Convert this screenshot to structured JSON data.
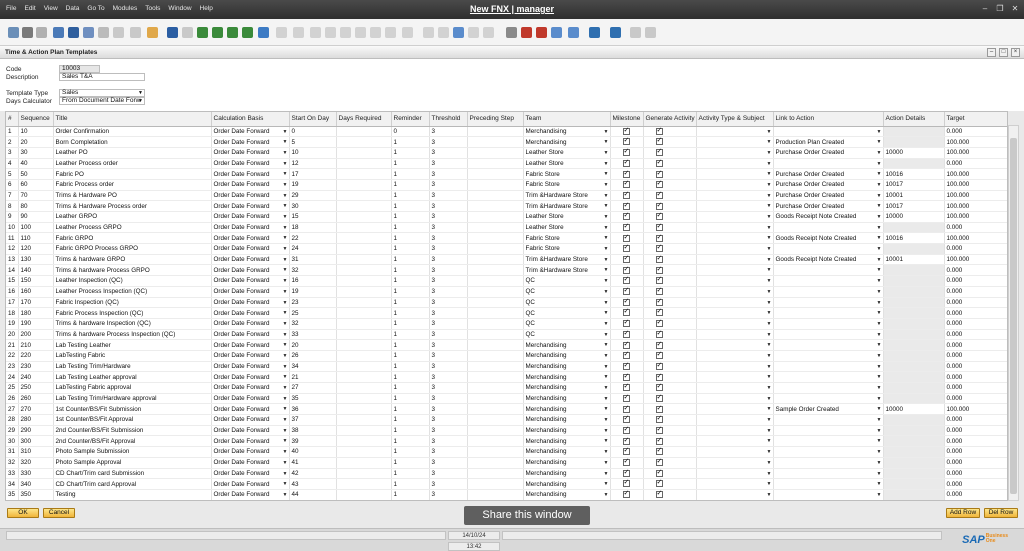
{
  "menu": [
    "File",
    "Edit",
    "View",
    "Data",
    "Go To",
    "Modules",
    "Tools",
    "Window",
    "Help"
  ],
  "app_title": "New FNX | manager",
  "window_title": "Time & Action Plan Templates",
  "form": {
    "code_label": "Code",
    "code": "10003",
    "description_label": "Description",
    "description": "Sales T&A",
    "template_type_label": "Template Type",
    "template_type": "Sales",
    "days_calc_label": "Days Calculator",
    "days_calc": "From Document Date Forw"
  },
  "columns": [
    "#",
    "Sequence",
    "Title",
    "Calculation Basis",
    "Start On Day",
    "Days Required",
    "Reminder",
    "Threshold",
    "Preceding Step",
    "Team",
    "Milestone",
    "Generate Activity",
    "Activity Type & Subject",
    "Link to Action",
    "Action Details",
    "Target"
  ],
  "rows": [
    {
      "n": "1",
      "seq": "10",
      "title": "Order Confirmation",
      "basis": "Order Date Forward",
      "start": "0",
      "rem": "0",
      "thr": "3",
      "team": "Merchandising",
      "link": "",
      "det": "",
      "target": "0.000"
    },
    {
      "n": "2",
      "seq": "20",
      "title": "Born Completation",
      "basis": "Order Date Forward",
      "start": "5",
      "rem": "1",
      "thr": "3",
      "team": "Merchandising",
      "link": "Production Plan Created",
      "det": "",
      "target": "100.000"
    },
    {
      "n": "3",
      "seq": "30",
      "title": "Leather PO",
      "basis": "Order Date Forward",
      "start": "10",
      "rem": "1",
      "thr": "3",
      "team": "Leather Store",
      "link": "Purchase Order Created",
      "det": "10000",
      "target": "100.000"
    },
    {
      "n": "4",
      "seq": "40",
      "title": "Leather Process order",
      "basis": "Order Date Forward",
      "start": "12",
      "rem": "1",
      "thr": "3",
      "team": "Leather Store",
      "link": "",
      "det": "",
      "target": "0.000"
    },
    {
      "n": "5",
      "seq": "50",
      "title": "Fabric PO",
      "basis": "Order Date Forward",
      "start": "17",
      "rem": "1",
      "thr": "3",
      "team": "Fabric Store",
      "link": "Purchase Order Created",
      "det": "10016",
      "target": "100.000"
    },
    {
      "n": "6",
      "seq": "60",
      "title": "Fabric Process order",
      "basis": "Order Date Forward",
      "start": "19",
      "rem": "1",
      "thr": "3",
      "team": "Fabric Store",
      "link": "Purchase Order Created",
      "det": "10017",
      "target": "100.000"
    },
    {
      "n": "7",
      "seq": "70",
      "title": "Trims & Hardware PO",
      "basis": "Order Date Forward",
      "start": "29",
      "rem": "1",
      "thr": "3",
      "team": "Trim &Hardware Store",
      "link": "Purchase Order Created",
      "det": "10001",
      "target": "100.000"
    },
    {
      "n": "8",
      "seq": "80",
      "title": "Trims & Hardware  Process order",
      "basis": "Order Date Forward",
      "start": "30",
      "rem": "1",
      "thr": "3",
      "team": "Trim &Hardware Store",
      "link": "Purchase Order Created",
      "det": "10017",
      "target": "100.000"
    },
    {
      "n": "9",
      "seq": "90",
      "title": "Leather GRPO",
      "basis": "Order Date Forward",
      "start": "15",
      "rem": "1",
      "thr": "3",
      "team": "Leather Store",
      "link": "Goods Receipt Note Created",
      "det": "10000",
      "target": "100.000"
    },
    {
      "n": "10",
      "seq": "100",
      "title": "Leather Process GRPO",
      "basis": "Order Date Forward",
      "start": "18",
      "rem": "1",
      "thr": "3",
      "team": "Leather Store",
      "link": "",
      "det": "",
      "target": "0.000"
    },
    {
      "n": "11",
      "seq": "110",
      "title": "Fabric GRPO",
      "basis": "Order Date Forward",
      "start": "22",
      "rem": "1",
      "thr": "3",
      "team": "Fabric Store",
      "link": "Goods Receipt Note Created",
      "det": "10016",
      "target": "100.000"
    },
    {
      "n": "12",
      "seq": "120",
      "title": "Fabric GRPO  Process GRPO",
      "basis": "Order Date Forward",
      "start": "24",
      "rem": "1",
      "thr": "3",
      "team": "Fabric Store",
      "link": "",
      "det": "",
      "target": "0.000"
    },
    {
      "n": "13",
      "seq": "130",
      "title": "Trims & hardware GRPO",
      "basis": "Order Date Forward",
      "start": "31",
      "rem": "1",
      "thr": "3",
      "team": "Trim &Hardware Store",
      "link": "Goods Receipt Note Created",
      "det": "10001",
      "target": "100.000"
    },
    {
      "n": "14",
      "seq": "140",
      "title": "Trims & hardware Process GRPO",
      "basis": "Order Date Forward",
      "start": "32",
      "rem": "1",
      "thr": "3",
      "team": "Trim &Hardware Store",
      "link": "",
      "det": "",
      "target": "0.000"
    },
    {
      "n": "15",
      "seq": "150",
      "title": "Leather Inspection (QC)",
      "basis": "Order Date Forward",
      "start": "16",
      "rem": "1",
      "thr": "3",
      "team": "QC",
      "link": "",
      "det": "",
      "target": "0.000"
    },
    {
      "n": "16",
      "seq": "160",
      "title": "Leather  Process Inspection (QC)",
      "basis": "Order Date Forward",
      "start": "19",
      "rem": "1",
      "thr": "3",
      "team": "QC",
      "link": "",
      "det": "",
      "target": "0.000"
    },
    {
      "n": "17",
      "seq": "170",
      "title": "Fabric Inspection (QC)",
      "basis": "Order Date Forward",
      "start": "23",
      "rem": "1",
      "thr": "3",
      "team": "QC",
      "link": "",
      "det": "",
      "target": "0.000"
    },
    {
      "n": "18",
      "seq": "180",
      "title": "Fabric Process  Inspection (QC)",
      "basis": "Order Date Forward",
      "start": "25",
      "rem": "1",
      "thr": "3",
      "team": "QC",
      "link": "",
      "det": "",
      "target": "0.000"
    },
    {
      "n": "19",
      "seq": "190",
      "title": "Trims & hardware Inspection (QC)",
      "basis": "Order Date Forward",
      "start": "32",
      "rem": "1",
      "thr": "3",
      "team": "QC",
      "link": "",
      "det": "",
      "target": "0.000"
    },
    {
      "n": "20",
      "seq": "200",
      "title": "Trims & hardware Process Inspection (QC)",
      "basis": "Order Date Forward",
      "start": "33",
      "rem": "1",
      "thr": "3",
      "team": "QC",
      "link": "",
      "det": "",
      "target": "0.000"
    },
    {
      "n": "21",
      "seq": "210",
      "title": "Lab Testing Leather",
      "basis": "Order Date Forward",
      "start": "20",
      "rem": "1",
      "thr": "3",
      "team": "Merchandising",
      "link": "",
      "det": "",
      "target": "0.000"
    },
    {
      "n": "22",
      "seq": "220",
      "title": "LabTesting Fabric",
      "basis": "Order Date Forward",
      "start": "26",
      "rem": "1",
      "thr": "3",
      "team": "Merchandising",
      "link": "",
      "det": "",
      "target": "0.000"
    },
    {
      "n": "23",
      "seq": "230",
      "title": "Lab Testing Trim/Hardware",
      "basis": "Order Date Forward",
      "start": "34",
      "rem": "1",
      "thr": "3",
      "team": "Merchandising",
      "link": "",
      "det": "",
      "target": "0.000"
    },
    {
      "n": "24",
      "seq": "240",
      "title": "Lab Testing Leather approval",
      "basis": "Order Date Forward",
      "start": "21",
      "rem": "1",
      "thr": "3",
      "team": "Merchandising",
      "link": "",
      "det": "",
      "target": "0.000"
    },
    {
      "n": "25",
      "seq": "250",
      "title": "LabTesting Fabric  approval",
      "basis": "Order Date Forward",
      "start": "27",
      "rem": "1",
      "thr": "3",
      "team": "Merchandising",
      "link": "",
      "det": "",
      "target": "0.000"
    },
    {
      "n": "26",
      "seq": "260",
      "title": "Lab Testing Trim/Hardware  approval",
      "basis": "Order Date Forward",
      "start": "35",
      "rem": "1",
      "thr": "3",
      "team": "Merchandising",
      "link": "",
      "det": "",
      "target": "0.000"
    },
    {
      "n": "27",
      "seq": "270",
      "title": "1st Counter/BS/Fit Submission",
      "basis": "Order Date Forward",
      "start": "36",
      "rem": "1",
      "thr": "3",
      "team": "Merchandising",
      "link": "Sample Order Created",
      "det": "10000",
      "target": "100.000"
    },
    {
      "n": "28",
      "seq": "280",
      "title": "1st Counter/BS/Fit Approval",
      "basis": "Order Date Forward",
      "start": "37",
      "rem": "1",
      "thr": "3",
      "team": "Merchandising",
      "link": "",
      "det": "",
      "target": "0.000"
    },
    {
      "n": "29",
      "seq": "290",
      "title": "2nd Counter/BS/Fit Submission",
      "basis": "Order Date Forward",
      "start": "38",
      "rem": "1",
      "thr": "3",
      "team": "Merchandising",
      "link": "",
      "det": "",
      "target": "0.000"
    },
    {
      "n": "30",
      "seq": "300",
      "title": "2nd Counter/BS/Fit Approval",
      "basis": "Order Date Forward",
      "start": "39",
      "rem": "1",
      "thr": "3",
      "team": "Merchandising",
      "link": "",
      "det": "",
      "target": "0.000"
    },
    {
      "n": "31",
      "seq": "310",
      "title": "Photo Sample Submission",
      "basis": "Order Date Forward",
      "start": "40",
      "rem": "1",
      "thr": "3",
      "team": "Merchandising",
      "link": "",
      "det": "",
      "target": "0.000"
    },
    {
      "n": "32",
      "seq": "320",
      "title": "Photo Sample Approval",
      "basis": "Order Date Forward",
      "start": "41",
      "rem": "1",
      "thr": "3",
      "team": "Merchandising",
      "link": "",
      "det": "",
      "target": "0.000"
    },
    {
      "n": "33",
      "seq": "330",
      "title": "CD Chart/Trim card Submission",
      "basis": "Order Date Forward",
      "start": "42",
      "rem": "1",
      "thr": "3",
      "team": "Merchandising",
      "link": "",
      "det": "",
      "target": "0.000"
    },
    {
      "n": "34",
      "seq": "340",
      "title": "CD Chart/Trim card Approval",
      "basis": "Order Date Forward",
      "start": "43",
      "rem": "1",
      "thr": "3",
      "team": "Merchandising",
      "link": "",
      "det": "",
      "target": "0.000"
    },
    {
      "n": "35",
      "seq": "350",
      "title": "Testing",
      "basis": "Order Date Forward",
      "start": "44",
      "rem": "1",
      "thr": "3",
      "team": "Merchandising",
      "link": "",
      "det": "",
      "target": "0.000"
    }
  ],
  "buttons": {
    "ok": "OK",
    "cancel": "Cancel",
    "add_row": "Add Row",
    "del_row": "Del Row"
  },
  "share_banner": "Share this window",
  "status": {
    "date": "14/10/24",
    "time": "13:42"
  },
  "logo": {
    "sap": "SAP",
    "product_line1": "Business",
    "product_line2": "One"
  },
  "colors": {
    "button_accent": "#f0b43a",
    "logo_blue": "#1a6ab5",
    "logo_orange": "#e88b1a"
  }
}
